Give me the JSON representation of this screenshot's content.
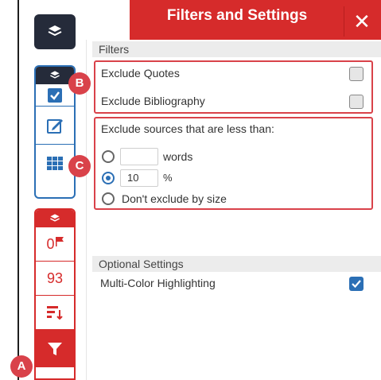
{
  "header": {
    "title": "Filters and Settings",
    "close_glyph": "✕"
  },
  "sections": {
    "filters": "Filters",
    "optional": "Optional Settings"
  },
  "filters": {
    "exclude_quotes": {
      "label": "Exclude Quotes",
      "checked": false
    },
    "exclude_bibliography": {
      "label": "Exclude Bibliography",
      "checked": false
    },
    "size_prompt": "Exclude sources that are less than:",
    "words_option": {
      "value": "",
      "unit": "words",
      "selected": false
    },
    "percent_option": {
      "value": "10",
      "unit": "%",
      "selected": true
    },
    "no_size_option": {
      "label": "Don't exclude by size",
      "selected": false
    }
  },
  "optional": {
    "multicolor": {
      "label": "Multi-Color Highlighting",
      "checked": true
    }
  },
  "sidebar": {
    "flag_count": "0",
    "score": "93"
  },
  "callouts": {
    "a": "A",
    "b": "B",
    "c": "C"
  },
  "colors": {
    "accent_red": "#d62b2b",
    "accent_blue": "#2b6fb5",
    "rail_dark": "#252b3a"
  }
}
